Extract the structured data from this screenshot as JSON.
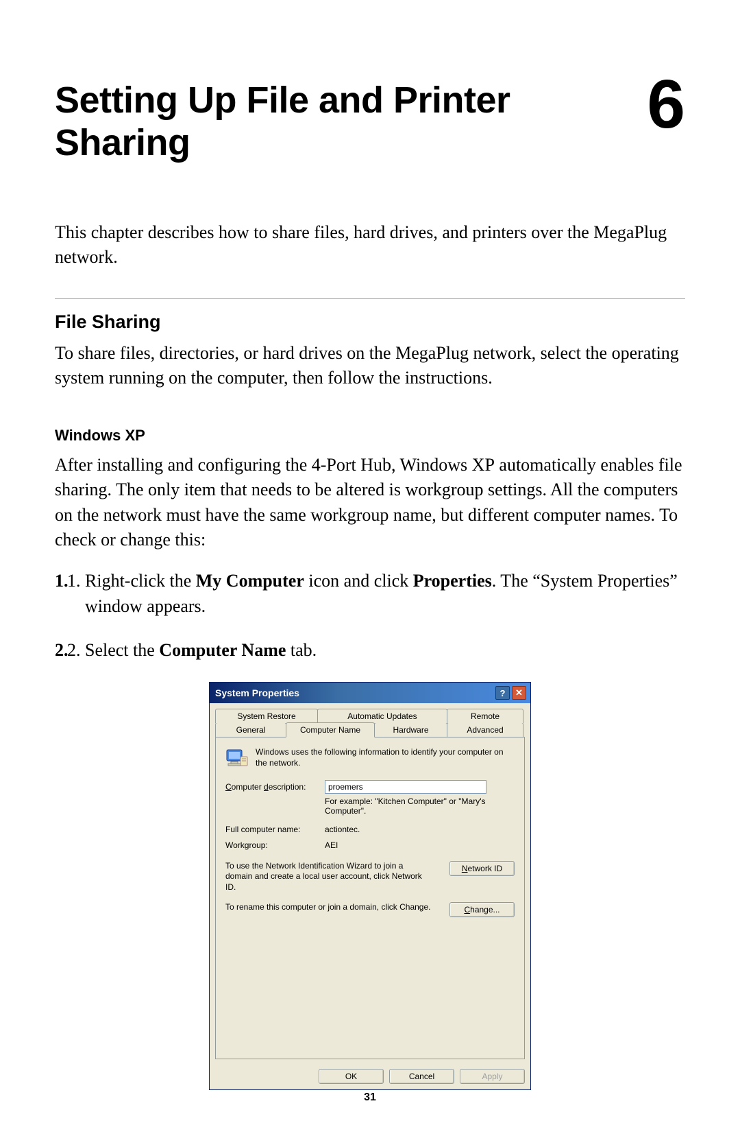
{
  "chapter": {
    "title": "Setting Up File and Printer Sharing",
    "number": "6"
  },
  "intro": "This chapter describes how to share files, hard drives, and printers over the MegaPlug network.",
  "section": {
    "title": "File Sharing",
    "body": "To share files, directories, or hard drives on the MegaPlug network, select the operating system running on the computer, then follow the instructions."
  },
  "subsection": {
    "title": "Windows XP",
    "body_pre": "After installing and configuring the 4-Port Hub, Windows ",
    "body_smallcaps": "XP",
    "body_post": " automatically enables file sharing. The only item that needs to be altered is workgroup settings. All the computers on the network must have the same workgroup name, but different computer names. To check or change this:"
  },
  "steps": [
    {
      "num": "1.",
      "pre": "Right-click the ",
      "b1": "My Computer",
      "mid": " icon and click ",
      "b2": "Properties",
      "post": ". The “System Properties” window appears."
    },
    {
      "num": "2.",
      "pre": "Select the ",
      "b1": "Computer Name",
      "post": " tab."
    }
  ],
  "dialog": {
    "title": "System Properties",
    "tabs_row1": [
      "System Restore",
      "Automatic Updates",
      "Remote"
    ],
    "tabs_row2": [
      "General",
      "Computer Name",
      "Hardware",
      "Advanced"
    ],
    "active_tab": "Computer Name",
    "info_text": "Windows uses the following information to identify your computer on the network.",
    "desc_label": "Computer description:",
    "desc_value": "proemers",
    "desc_hint": "For example: \"Kitchen Computer\" or \"Mary's Computer\".",
    "fullname_label": "Full computer name:",
    "fullname_value": "actiontec.",
    "workgroup_label": "Workgroup:",
    "workgroup_value": "AEI",
    "netid_text": "To use the Network Identification Wizard to join a domain and create a local user account, click Network ID.",
    "netid_btn": "Network ID",
    "change_text": "To rename this computer or join a domain, click Change.",
    "change_btn": "Change...",
    "ok_btn": "OK",
    "cancel_btn": "Cancel",
    "apply_btn": "Apply"
  },
  "page_number": "31"
}
